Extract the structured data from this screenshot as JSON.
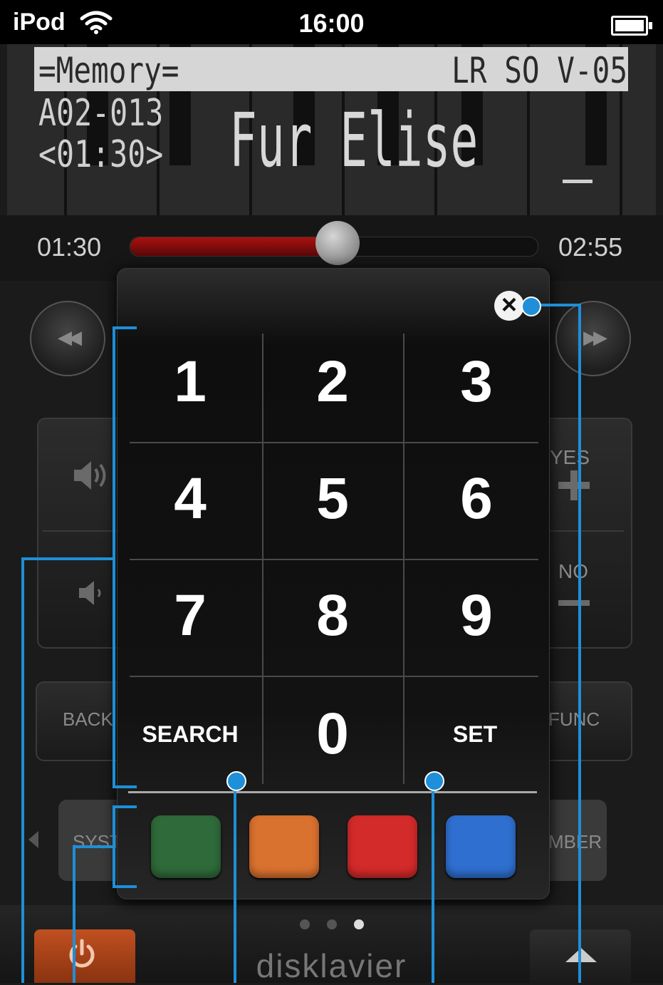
{
  "status_bar": {
    "carrier": "iPod",
    "time": "16:00"
  },
  "lcd": {
    "mode": "=Memory=",
    "status": "LR SO V-05",
    "track_number": "A02-013",
    "track_time": "<01:30>",
    "title": "Fur Elise"
  },
  "progress": {
    "elapsed": "01:30",
    "total": "02:55",
    "fraction": 0.51
  },
  "background_controls": {
    "yes_label": "YES",
    "no_label": "NO",
    "back_label": "BACK",
    "func_label": "FUNC",
    "system_tab_label": "SYST",
    "number_tab_label": "MBER",
    "brand": "disklavier"
  },
  "keypad": {
    "keys": [
      {
        "label": "1"
      },
      {
        "label": "2"
      },
      {
        "label": "3"
      },
      {
        "label": "4"
      },
      {
        "label": "5"
      },
      {
        "label": "6"
      },
      {
        "label": "7"
      },
      {
        "label": "8"
      },
      {
        "label": "9"
      },
      {
        "label": "SEARCH"
      },
      {
        "label": "0"
      },
      {
        "label": "SET"
      }
    ],
    "color_keys": [
      "#2f6a3a",
      "#d9712f",
      "#d32a2a",
      "#2f6fd0"
    ]
  },
  "page_indicator": {
    "count": 3,
    "active": 3
  },
  "icons": [
    "wifi-icon",
    "battery-icon",
    "close-icon",
    "rewind-icon",
    "fast-forward-icon",
    "speaker-loud-icon",
    "speaker-quiet-icon",
    "plus-icon",
    "minus-icon",
    "power-icon",
    "up-arrow-icon"
  ],
  "accent_color": "#1e8fd8"
}
